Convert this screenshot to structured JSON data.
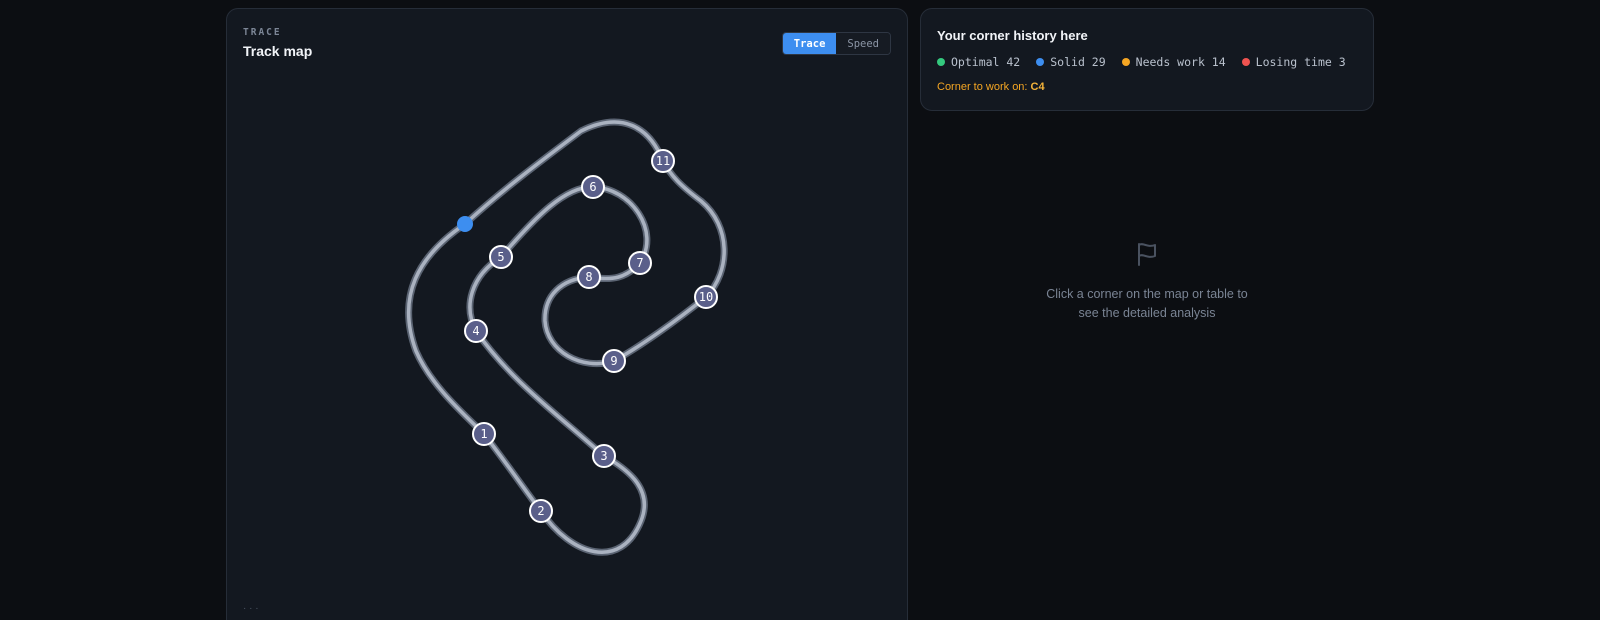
{
  "trace_panel": {
    "eyebrow": "TRACE",
    "title": "Track map",
    "toggle": [
      {
        "label": "Trace",
        "active": true
      },
      {
        "label": "Speed",
        "active": false
      }
    ],
    "footer_hint": "· · ·"
  },
  "corners": [
    "1",
    "2",
    "3",
    "4",
    "5",
    "6",
    "7",
    "8",
    "9",
    "10",
    "11"
  ],
  "history_panel": {
    "title": "Your corner history here",
    "legend": [
      {
        "label": "Optimal 42",
        "color": "#34c97e"
      },
      {
        "label": "Solid 29",
        "color": "#3d8ef0"
      },
      {
        "label": "Needs work 14",
        "color": "#f5a623"
      },
      {
        "label": "Losing time 3",
        "color": "#ef5350"
      }
    ],
    "focus_prefix": "Corner to work on:",
    "focus_corner": "C4"
  },
  "empty_state": {
    "icon": "flag-icon",
    "line1": "Click a corner on the map or table to",
    "line2": "see the detailed analysis"
  },
  "colors": {
    "accent": "#3d8ef0",
    "track": "#a8b0bf",
    "marker_fill": "#5a5f8a"
  }
}
